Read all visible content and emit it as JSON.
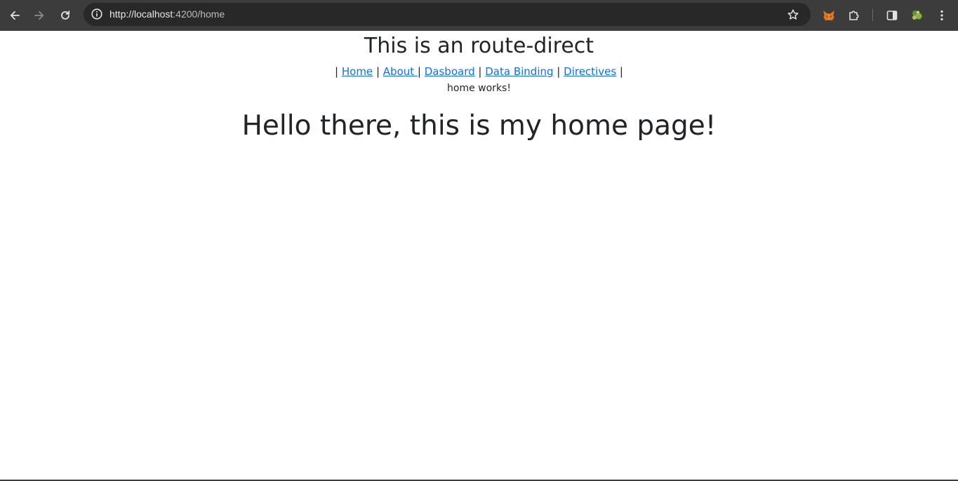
{
  "browser": {
    "url_host": "http://localhost",
    "url_rest": ":4200/home",
    "icons": {
      "back": "arrow-left-icon",
      "forward": "arrow-right-icon",
      "reload": "reload-icon",
      "site_info": "info-icon",
      "bookmark": "star-icon",
      "metamask": "fox-icon",
      "extensions": "puzzle-icon",
      "side_panel": "side-panel-icon",
      "profile": "avatar",
      "menu": "kebab-menu-icon"
    },
    "colors": {
      "toolbar_bg": "#3c3c3c",
      "omnibox_bg": "#282828"
    }
  },
  "app": {
    "title": "This is an route-direct",
    "nav": {
      "sep": "|",
      "links": [
        "Home",
        "About ",
        "Dasboard",
        "Data Binding",
        "Directives"
      ]
    },
    "status_text": "home works!",
    "headline": "Hello there, this is my home page!",
    "colors": {
      "text": "#212529",
      "link": "#0d6efd"
    }
  }
}
